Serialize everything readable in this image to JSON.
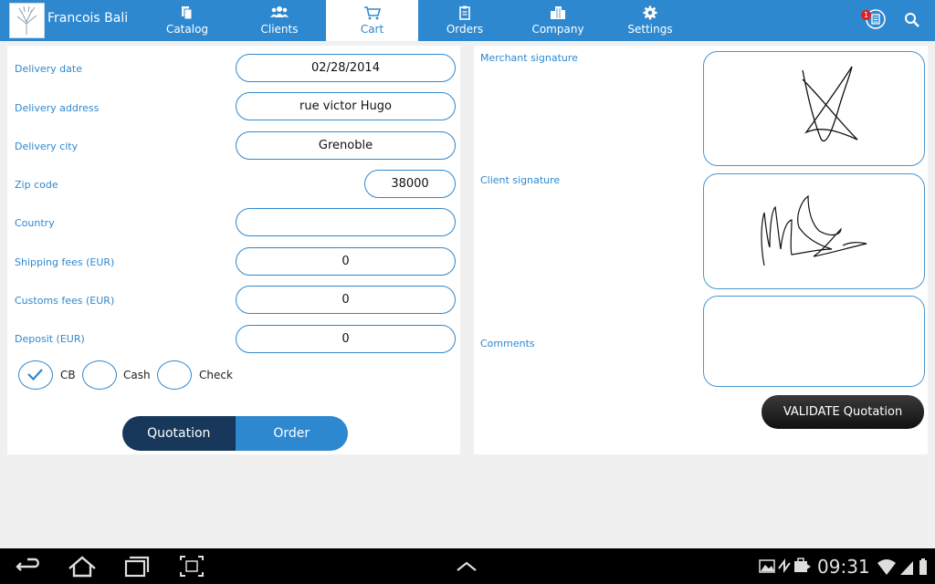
{
  "header": {
    "title": "Francois Bali",
    "tabs": [
      {
        "label": "Catalog",
        "icon": "catalog-icon"
      },
      {
        "label": "Clients",
        "icon": "clients-icon"
      },
      {
        "label": "Cart",
        "icon": "cart-icon"
      },
      {
        "label": "Orders",
        "icon": "orders-icon"
      },
      {
        "label": "Company",
        "icon": "company-icon"
      },
      {
        "label": "Settings",
        "icon": "settings-icon"
      }
    ],
    "active_tab": "Cart",
    "notification_count": "1",
    "colors": {
      "bar": "#2e88cf",
      "active_tab_bg": "#ffffff"
    }
  },
  "form": {
    "delivery_date": {
      "label": "Delivery date",
      "value": "02/28/2014"
    },
    "delivery_address": {
      "label": "Delivery address",
      "value": "rue victor Hugo"
    },
    "delivery_city": {
      "label": "Delivery city",
      "value": "Grenoble"
    },
    "zip_code": {
      "label": "Zip code",
      "value": "38000"
    },
    "country": {
      "label": "Country",
      "value": ""
    },
    "shipping_fees": {
      "label": "Shipping fees (EUR)",
      "value": "0"
    },
    "customs_fees": {
      "label": "Customs fees (EUR)",
      "value": "0"
    },
    "deposit": {
      "label": "Deposit (EUR)",
      "value": "0"
    }
  },
  "payment": [
    {
      "label": "CB",
      "checked": true
    },
    {
      "label": "Cash",
      "checked": false
    },
    {
      "label": "Check",
      "checked": false
    }
  ],
  "mode_toggle": {
    "quotation": "Quotation",
    "order": "Order",
    "selected": "Quotation"
  },
  "signatures": {
    "merchant_label": "Merchant signature",
    "client_label": "Client signature",
    "comments_label": "Comments",
    "comments_value": ""
  },
  "validate_button": "VALIDATE Quotation",
  "system_bar": {
    "time": "09:31"
  }
}
